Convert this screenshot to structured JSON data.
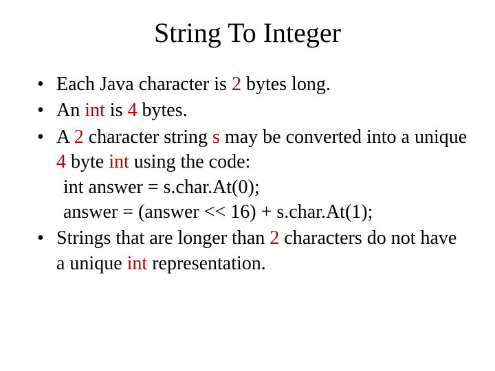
{
  "title": "String To Integer",
  "bullets": {
    "b1": {
      "t1": "Each Java character is ",
      "n1": "2",
      "t2": " bytes long."
    },
    "b2": {
      "t1": "An ",
      "kw1": "int",
      "t2": " is ",
      "n1": "4",
      "t3": " bytes."
    },
    "b3": {
      "t1": "A ",
      "n1": "2",
      "t2": " character string ",
      "kw1": "s",
      "t3": " may be converted into a unique ",
      "n2": "4",
      "t4": " byte ",
      "kw2": "int",
      "t5": " using the code:",
      "code1": "int answer = s.char.At(0);",
      "code2": "answer = (answer << 16) + s.char.At(1);"
    },
    "b4": {
      "t1": "Strings that are longer than ",
      "n1": "2",
      "t2": " characters do not have a unique ",
      "kw1": "int",
      "t3": " representation."
    }
  }
}
